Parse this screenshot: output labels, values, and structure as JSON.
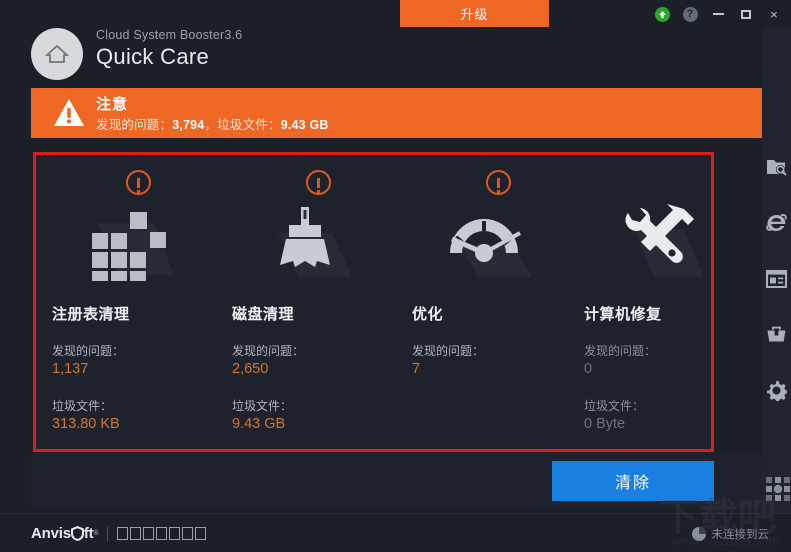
{
  "window": {
    "app_name": "Cloud System Booster3.6",
    "page_title": "Quick Care",
    "upgrade_label": "升级",
    "controls": {
      "upgrade_arrow": "up-arrow-icon",
      "help": "question-mark-icon",
      "minimize": "minimize-icon",
      "maximize": "maximize-icon",
      "close": "×"
    },
    "home_icon": "home-icon"
  },
  "banner": {
    "icon": "warning-triangle-icon",
    "title": "注意",
    "subtitle_prefix": "发现的问题：",
    "issues_found": "3,794",
    "subtitle_mid": "，垃圾文件：",
    "junk_size": "9.43 GB",
    "background_color": "#ee6724"
  },
  "cards": {
    "border_color": "#e01b1b",
    "items": [
      {
        "id": "registry-clean",
        "icon": "registry-blocks-icon",
        "alert": true,
        "title": "注册表清理",
        "issues_label": "发现的问题：",
        "issues_value": "1,137",
        "junk_label": "垃圾文件：",
        "junk_value": "313.80 KB"
      },
      {
        "id": "disk-clean",
        "icon": "broom-icon",
        "alert": true,
        "title": "磁盘清理",
        "issues_label": "发现的问题：",
        "issues_value": "2,650",
        "junk_label": "垃圾文件：",
        "junk_value": "9.43 GB"
      },
      {
        "id": "optimize",
        "icon": "speedometer-icon",
        "alert": true,
        "title": "优化",
        "issues_label": "发现的问题：",
        "issues_value": "7",
        "junk_label": "",
        "junk_value": ""
      },
      {
        "id": "computer-repair",
        "icon": "wrench-hammer-icon",
        "alert": false,
        "title": "计算机修复",
        "issues_label": "发现的问题：",
        "issues_value": "0",
        "junk_label": "垃圾文件：",
        "junk_value": "0 Byte"
      }
    ]
  },
  "action": {
    "clear_label": "清除",
    "clear_color": "#1a7fe0"
  },
  "footer": {
    "brand": "Anvis",
    "brand_tail": "ft",
    "brand_tm": "®",
    "tofu_count": 7,
    "cloud_status": "未连接到云"
  },
  "sidebar": {
    "items": [
      {
        "id": "scan",
        "icon": "folder-search-icon"
      },
      {
        "id": "browser",
        "icon": "internet-explorer-icon"
      },
      {
        "id": "news",
        "icon": "news-article-icon"
      },
      {
        "id": "toolbox",
        "icon": "toolbox-icon"
      },
      {
        "id": "settings",
        "icon": "gear-icon"
      }
    ],
    "grid_icon": "apps-grid-icon"
  },
  "watermark": {
    "big": "下载吧",
    "small": "www.xiazaiba.com"
  }
}
